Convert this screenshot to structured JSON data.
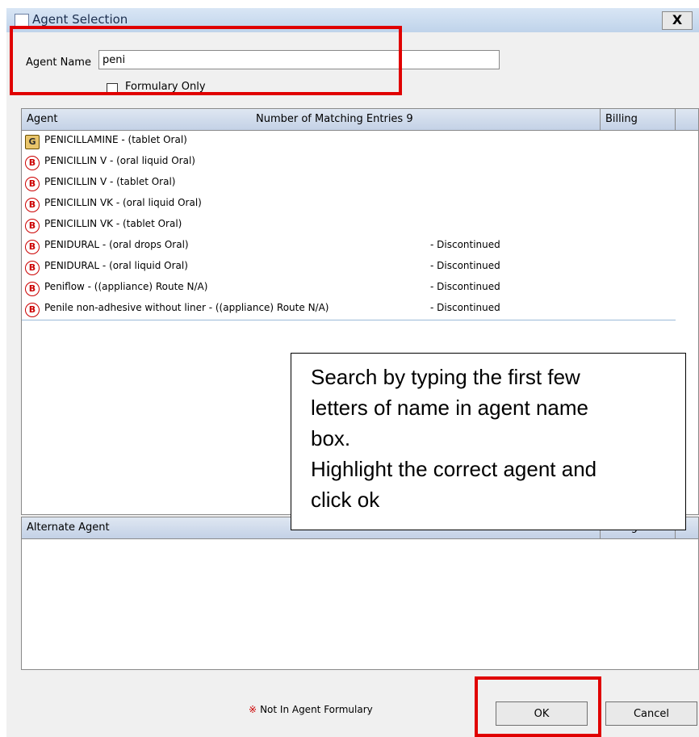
{
  "window": {
    "title": "Agent Selection",
    "close_label": "X"
  },
  "search": {
    "label": "Agent Name",
    "value": "peni"
  },
  "formulary": {
    "label": "Formulary Only",
    "checked": false
  },
  "list": {
    "header_agent": "Agent",
    "header_count": "Number of Matching Entries 9",
    "header_billing": "Billing",
    "rows": [
      {
        "badge": "G",
        "name": "PENICILLAMINE - (tablet Oral)",
        "status": ""
      },
      {
        "badge": "B",
        "name": "PENICILLIN V - (oral liquid Oral)",
        "status": ""
      },
      {
        "badge": "B",
        "name": "PENICILLIN V - (tablet Oral)",
        "status": ""
      },
      {
        "badge": "B",
        "name": "PENICILLIN VK - (oral liquid Oral)",
        "status": ""
      },
      {
        "badge": "B",
        "name": "PENICILLIN VK - (tablet Oral)",
        "status": ""
      },
      {
        "badge": "B",
        "name": "PENIDURAL - (oral drops Oral)",
        "status": "- Discontinued"
      },
      {
        "badge": "B",
        "name": "PENIDURAL - (oral liquid Oral)",
        "status": "- Discontinued"
      },
      {
        "badge": "B",
        "name": "Peniflow - ((appliance) Route N/A)",
        "status": "- Discontinued"
      },
      {
        "badge": "B",
        "name": "Penile non-adhesive without liner - ((appliance) Route N/A)",
        "status": "- Discontinued"
      }
    ]
  },
  "alternate": {
    "header": "Alternate Agent",
    "billing": "Billing"
  },
  "tooltip": {
    "lines": [
      "Search by typing the first few",
      "letters of name in agent name",
      "box.",
      "Highlight the correct agent and",
      "click ok"
    ]
  },
  "footer": {
    "star": "※",
    "note": "Not In Agent Formulary",
    "ok_label": "OK",
    "cancel_label": "Cancel"
  },
  "colors": {
    "highlight_box": "#e00000",
    "header_gradient_start": "#dfe7f2",
    "header_gradient_end": "#c3d1e6"
  }
}
